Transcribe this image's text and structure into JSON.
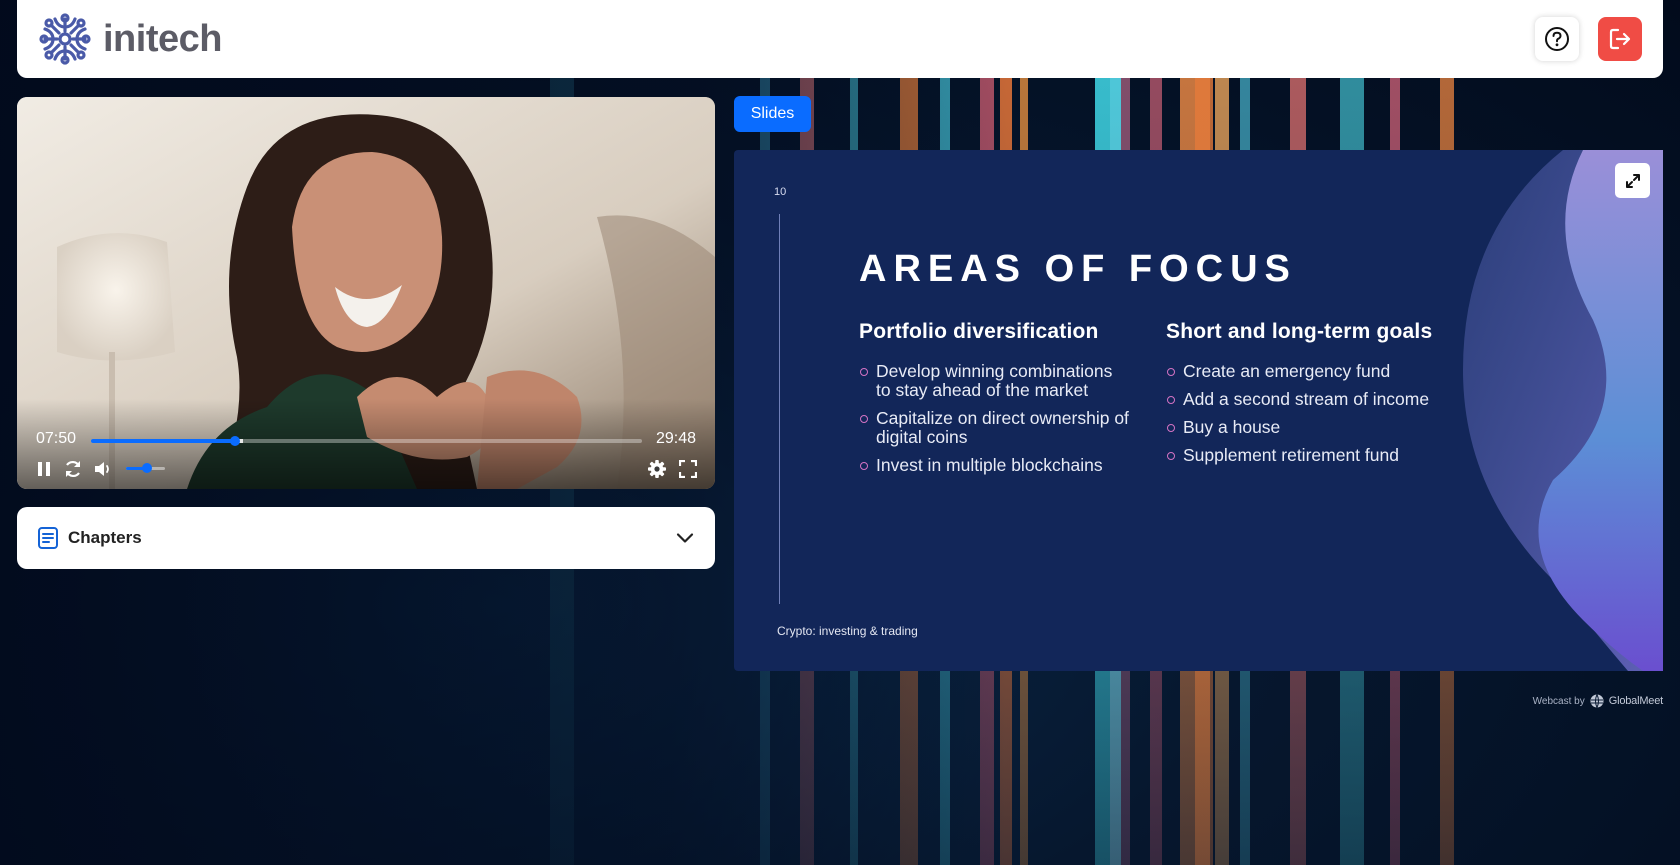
{
  "app": {
    "brand": "initech"
  },
  "header": {
    "help_icon": "question-circle-icon",
    "logout_icon": "logout-icon",
    "logout_color": "#f04c45"
  },
  "player": {
    "current_time": "07:50",
    "duration": "29:48",
    "progress_fraction": 0.262,
    "buffered_fraction": 0.275,
    "volume_fraction": 0.55,
    "accent_color": "#0a6cff",
    "controls": [
      "pause-icon",
      "replay-icon",
      "volume-icon",
      "settings-icon",
      "fullscreen-icon"
    ]
  },
  "chapters": {
    "label": "Chapters",
    "icon": "document-list-icon",
    "toggle_icon": "chevron-down-icon"
  },
  "slides_tab": {
    "label": "Slides"
  },
  "slide": {
    "number": "10",
    "title": "AREAS OF FOCUS",
    "columns": [
      {
        "heading": "Portfolio diversification",
        "items": [
          "Develop winning combinations to stay ahead of the market",
          "Capitalize on direct ownership of digital coins",
          "Invest in multiple blockchains"
        ]
      },
      {
        "heading": "Short and long-term goals",
        "items": [
          "Create an emergency fund",
          "Add a second stream of income",
          "Buy a house",
          "Supplement retirement fund"
        ]
      }
    ],
    "footer": "Crypto: investing & trading",
    "background_color": "#122659",
    "bullet_color": "#d473c4"
  },
  "credit": {
    "prefix": "Webcast by",
    "brand": "GlobalMeet"
  }
}
